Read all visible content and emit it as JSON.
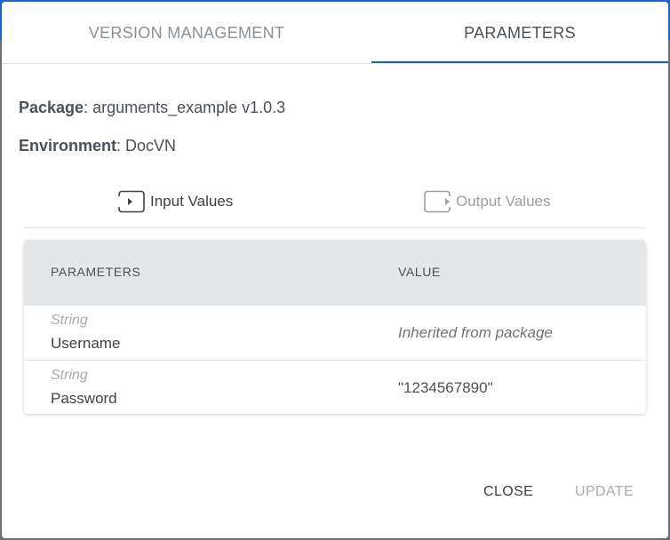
{
  "tabs": [
    {
      "label": "VERSION MANAGEMENT",
      "active": false
    },
    {
      "label": "PARAMETERS",
      "active": true
    }
  ],
  "info": {
    "package_label": "Package",
    "package_value": ": arguments_example v1.0.3",
    "environment_label": "Environment",
    "environment_value": ": DocVN"
  },
  "subtabs": [
    {
      "label": "Input Values",
      "icon": "input-box-icon",
      "active": true
    },
    {
      "label": "Output Values",
      "icon": "output-box-icon",
      "active": false
    }
  ],
  "table": {
    "headers": [
      "PARAMETERS",
      "VALUE"
    ],
    "rows": [
      {
        "type": "String",
        "name": "Username",
        "value": "Inherited from package"
      },
      {
        "type": "String",
        "name": "Password",
        "value": "\"1234567890\""
      }
    ]
  },
  "actions": {
    "close_label": "CLOSE",
    "update_label": "UPDATE"
  },
  "colors": {
    "accent": "#1f66c0",
    "header_bg": "#e3e7ea",
    "muted_text": "#a5abb0"
  }
}
